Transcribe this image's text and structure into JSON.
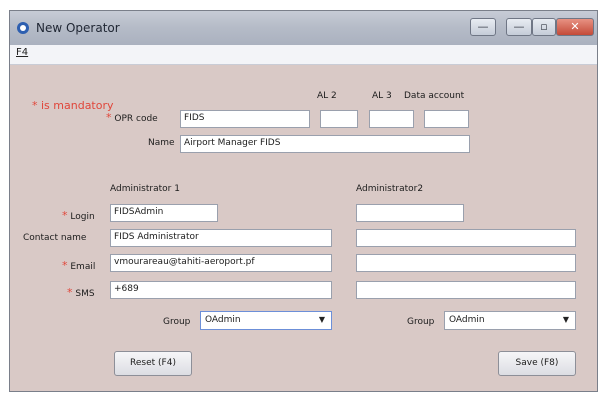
{
  "window": {
    "title": "New Operator"
  },
  "menu": {
    "f4": "F4"
  },
  "mandatory_note": "is mandatory",
  "star": "*",
  "header": {
    "al2": "AL 2",
    "al3": "AL 3",
    "data_account": "Data account"
  },
  "opr": {
    "code_label": "OPR code",
    "code_value": "FIDS",
    "al2_value": "",
    "al3_value": "",
    "data_account_value": ""
  },
  "name": {
    "label": "Name",
    "value": "Airport Manager FIDS"
  },
  "admin1": {
    "heading": "Administrator 1",
    "login_label": "Login",
    "login": "FIDSAdmin",
    "contact_label": "Contact name",
    "contact": "FIDS Administrator",
    "email_label": "Email",
    "email": "vmourareau@tahiti-aeroport.pf",
    "sms_label": "SMS",
    "sms": "+689",
    "group_label": "Group",
    "group": "OAdmin"
  },
  "admin2": {
    "heading": "Administrator2",
    "login": "",
    "contact": "",
    "email": "",
    "sms": "",
    "group_label": "Group",
    "group": "OAdmin"
  },
  "buttons": {
    "reset": "Reset (F4)",
    "save": "Save (F8)"
  },
  "colors": {
    "window_bg": "#d9c9c6",
    "mandatory": "#e0463a"
  }
}
